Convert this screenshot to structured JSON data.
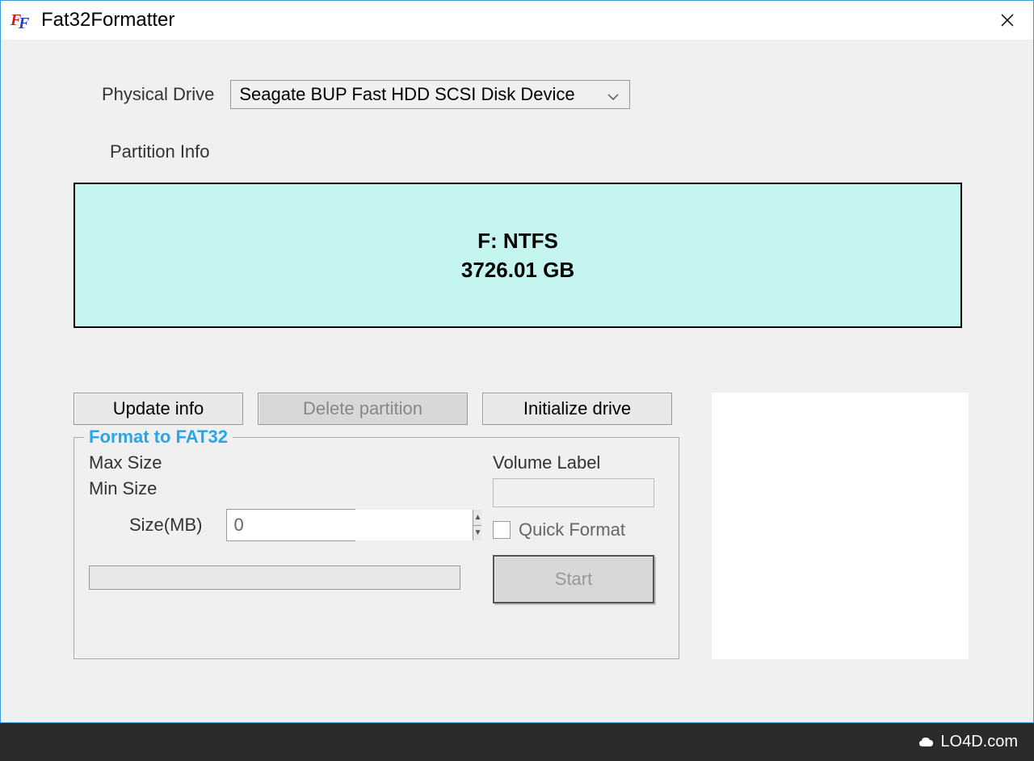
{
  "title": "Fat32Formatter",
  "labels": {
    "physical_drive": "Physical Drive",
    "partition_info": "Partition Info"
  },
  "drive_select": {
    "value": "Seagate BUP Fast HDD SCSI Disk Device"
  },
  "partition": {
    "line1": "F: NTFS",
    "line2": "3726.01 GB"
  },
  "buttons": {
    "update_info": "Update info",
    "delete_partition": "Delete partition",
    "initialize_drive": "Initialize drive"
  },
  "format_panel": {
    "legend": "Format to FAT32",
    "max_size_label": "Max Size",
    "min_size_label": "Min Size",
    "size_label": "Size(MB)",
    "size_value": "0",
    "volume_label": "Volume Label",
    "volume_value": "",
    "quick_format_label": "Quick Format",
    "quick_format_checked": false,
    "start_label": "Start"
  },
  "footer": {
    "brand": "LO4D.com"
  }
}
